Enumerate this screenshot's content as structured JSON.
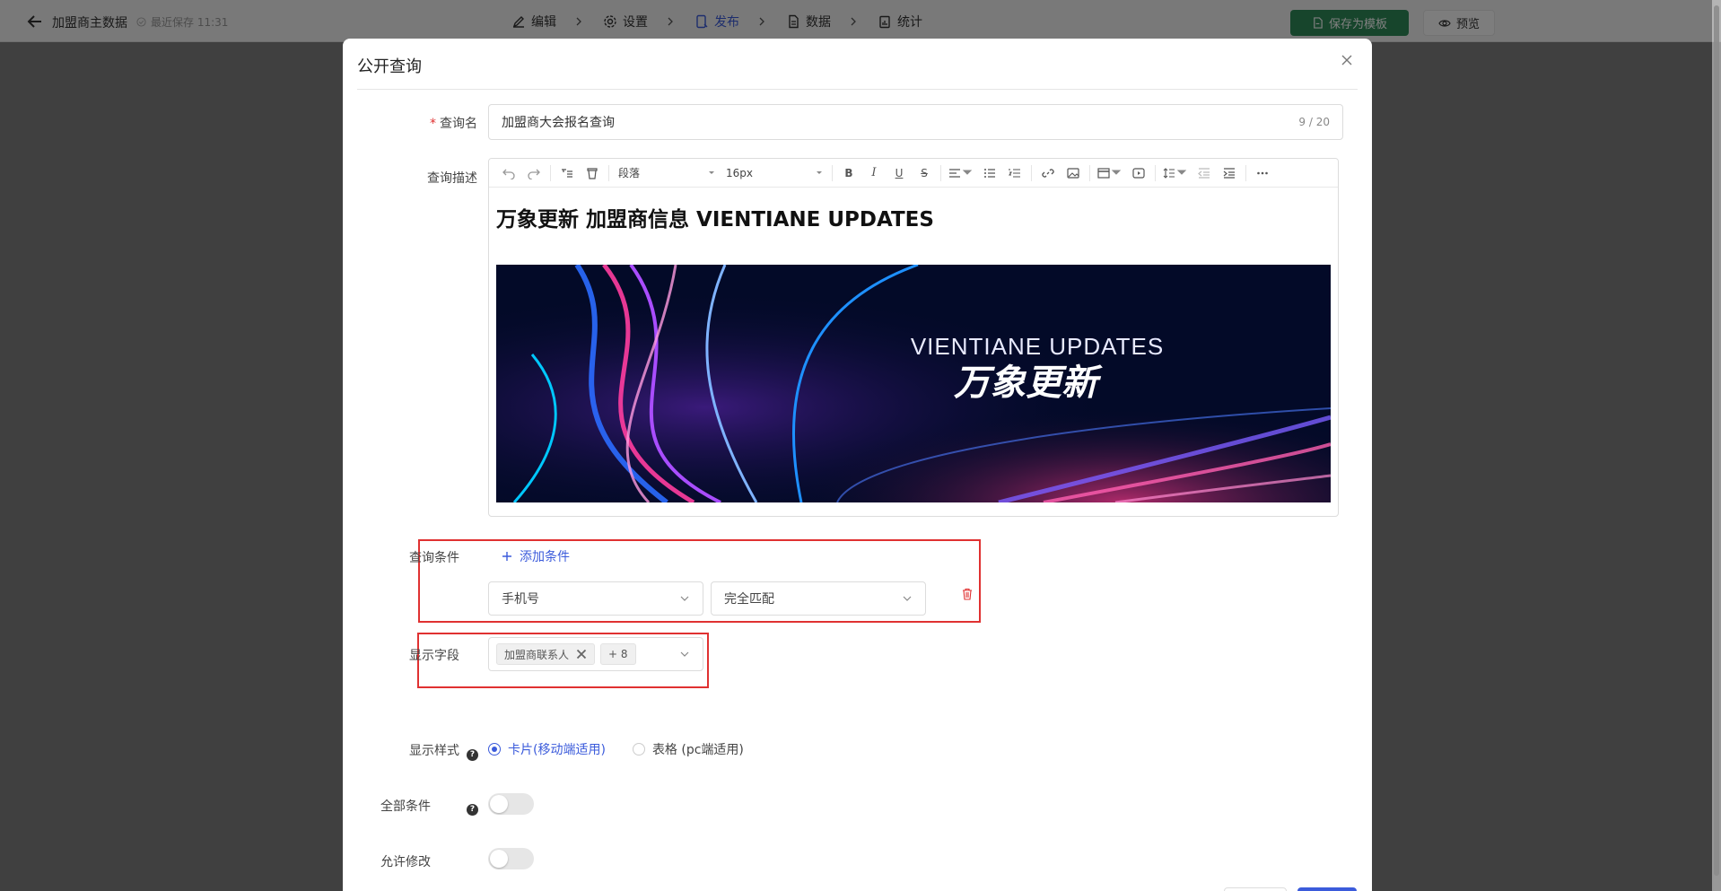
{
  "topbar": {
    "title": "加盟商主数据",
    "saved": "最近保存 11:31",
    "steps": [
      {
        "label": "编辑",
        "icon": "edit-icon"
      },
      {
        "label": "设置",
        "icon": "gear-icon"
      },
      {
        "label": "发布",
        "icon": "publish-icon"
      },
      {
        "label": "数据",
        "icon": "document-icon"
      },
      {
        "label": "统计",
        "icon": "stats-icon"
      }
    ],
    "save_template": "保存为模板",
    "preview": "预览"
  },
  "modal": {
    "title": "公开查询",
    "query_name": {
      "label": "查询名",
      "value": "加盟商大会报名查询",
      "counter": "9 / 20"
    },
    "description": {
      "label": "查询描述",
      "toolbar": {
        "paragraph": "段落",
        "font_size": "16px"
      },
      "heading": "万象更新 加盟商信息 VIENTIANE UPDATES",
      "banner_en": "VIENTIANE UPDATES",
      "banner_cn": "万象更新"
    },
    "conditions": {
      "label": "查询条件",
      "add": "添加条件",
      "field": "手机号",
      "match": "完全匹配"
    },
    "display_fields": {
      "label": "显示字段",
      "tag": "加盟商联系人",
      "more": "+ 8"
    },
    "display_style": {
      "label": "显示样式",
      "options": [
        "卡片(移动端适用)",
        "表格 (pc端适用)"
      ],
      "selected": 0
    },
    "all_conditions": {
      "label": "全部条件",
      "on": false
    },
    "allow_edit": {
      "label": "允许修改",
      "on": false
    }
  },
  "colors": {
    "accent": "#3b5bdb",
    "save_green": "#2e8a58",
    "highlight": "#e03131"
  }
}
